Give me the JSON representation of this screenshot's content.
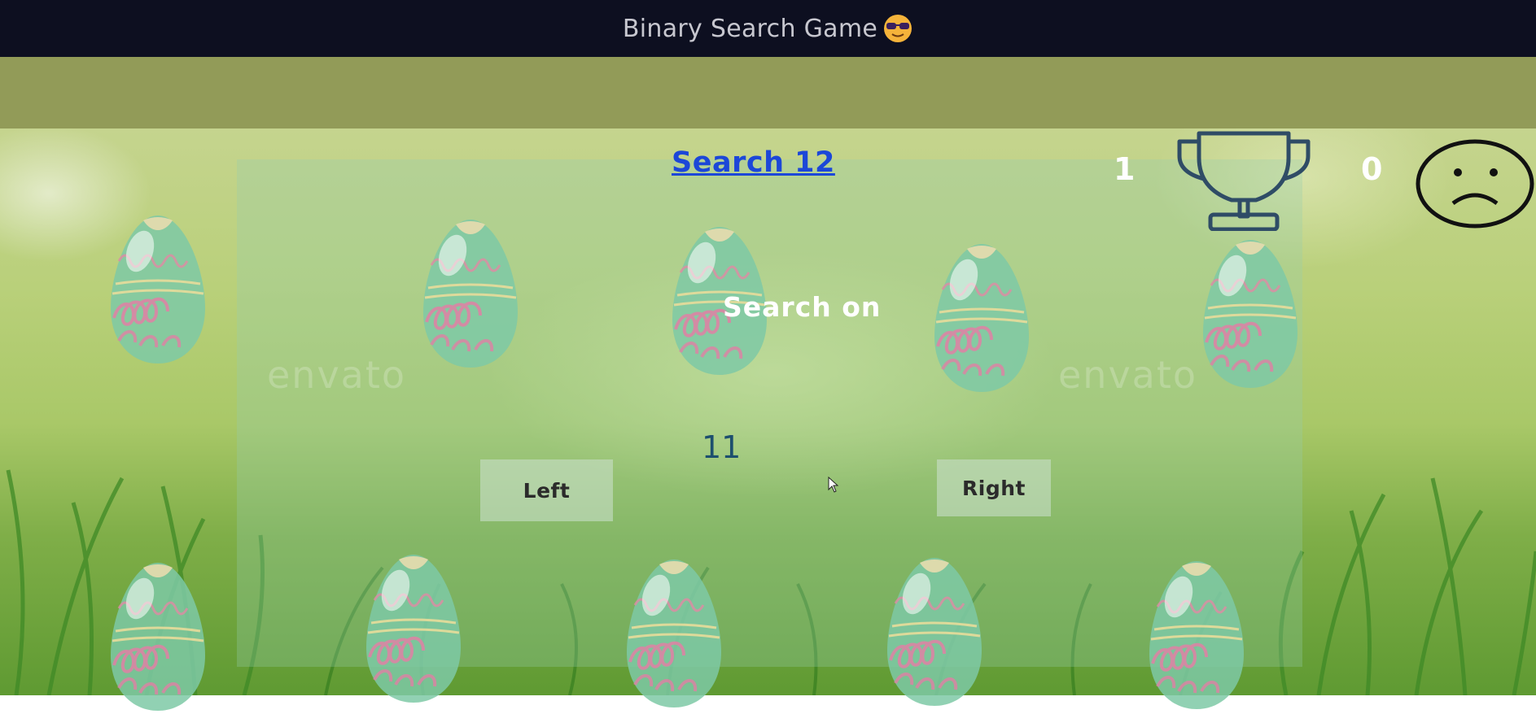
{
  "app": {
    "title": "Binary Search Game",
    "title_icon": "cool-sunglasses-emoji-icon"
  },
  "game": {
    "search_label": "Search 12",
    "score_wins": "1",
    "score_losses": "0",
    "search_on_label": "Search on",
    "current_number": "11",
    "left_button": "Left",
    "right_button": "Right",
    "wins_icon": "trophy-icon",
    "losses_icon": "sad-face-icon",
    "egg_icon": "easter-egg-icon",
    "watermark": "envato"
  },
  "colors": {
    "titlebar": "#0d0f20",
    "olive_bar": "#929b58",
    "search_link": "#1c47d8",
    "current_number": "#1d4f6e",
    "trophy": "#2f4c66"
  }
}
